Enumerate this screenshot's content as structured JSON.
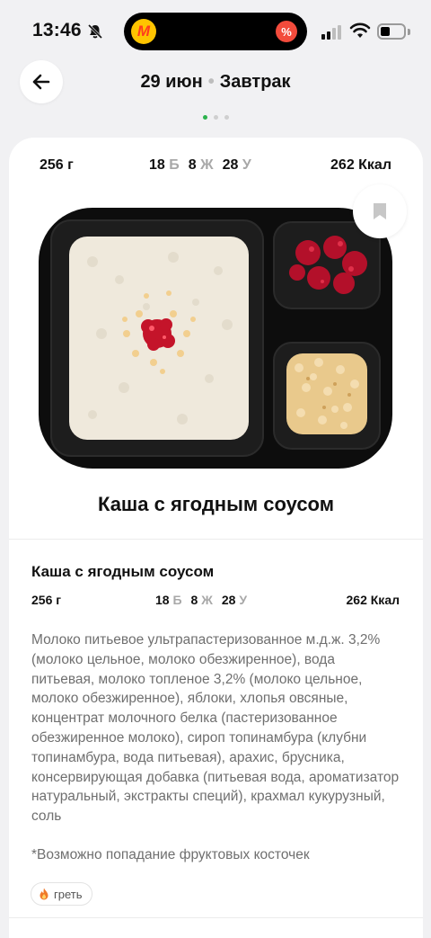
{
  "status_bar": {
    "time": "13:46",
    "island_app_letter": "M",
    "island_badge": "%"
  },
  "header": {
    "date": "29 июн",
    "separator": "•",
    "meal": "Завтрак",
    "page_count": 3,
    "active_page": 1
  },
  "summary": {
    "weight": "256 г",
    "protein_value": "18",
    "protein_letter": "Б",
    "fat_value": "8",
    "fat_letter": "Ж",
    "carbs_value": "28",
    "carbs_letter": "У",
    "kcal": "262 Ккал"
  },
  "dish": {
    "title": "Каша с ягодным соусом"
  },
  "details": {
    "title": "Каша с ягодным соусом",
    "weight": "256 г",
    "protein_value": "18",
    "protein_letter": "Б",
    "fat_value": "8",
    "fat_letter": "Ж",
    "carbs_value": "28",
    "carbs_letter": "У",
    "kcal": "262 Ккал",
    "ingredients": "Молоко питьевое ультрапастеризованное м.д.ж. 3,2% (молоко цельное, молоко обезжиренное), вода питьевая, молоко топленое 3,2% (молоко цельное, молоко обезжиренное), яблоки, хлопья овсяные, концентрат молочного белка (пастеризованное обезжиренное молоко), сироп топинамбура (клубни топинамбура, вода питьевая), арахис, брусника, консервирующая добавка (питьевая вода, ароматизатор натуральный, экстракты специй), крахмал кукурузный, соль",
    "note": "*Возможно попадание фруктовых косточек",
    "tag_icon": "flame-icon",
    "tag_label": "греть"
  },
  "colors": {
    "accent_green": "#2bb24c",
    "muted_text": "#6f6f6f",
    "background": "#f1f1f3"
  }
}
